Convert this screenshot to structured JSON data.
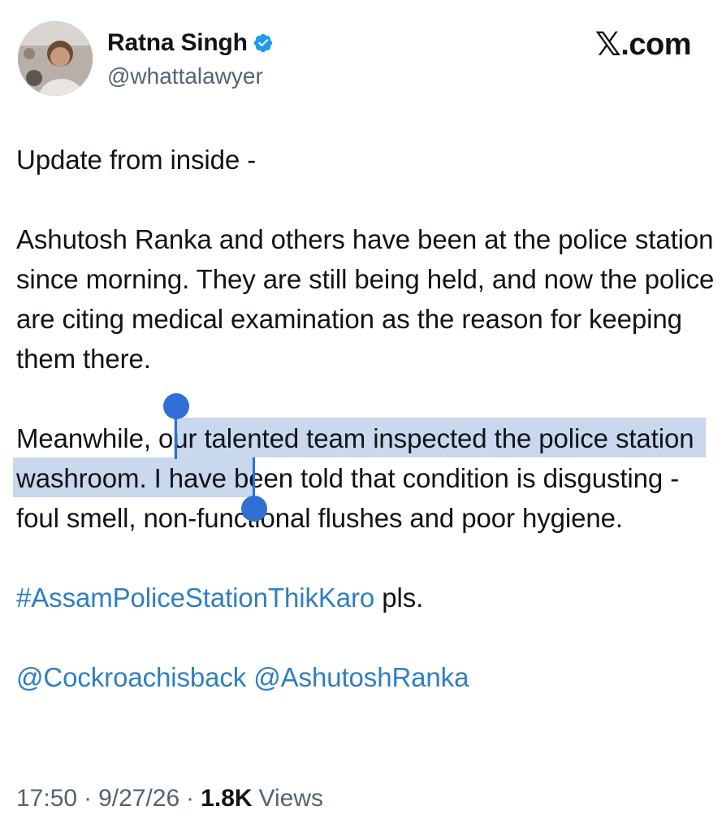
{
  "author": {
    "display_name": "Ratna Singh",
    "handle": "@whattalawyer",
    "verified": true,
    "avatar_icon": "profile-photo"
  },
  "brand": {
    "logo_glyph": "𝕏",
    "suffix": ".com"
  },
  "tweet": {
    "paragraph_1": "Update from inside -",
    "paragraph_2": "Ashutosh Ranka and others have been at the police station since morning. They are still being held, and now the police are citing medical examination as the reason for keeping them there.",
    "paragraph_3_before_selection": "Meanwhile, ",
    "paragraph_3_selected": "our talented team inspected the police station washroom",
    "paragraph_3_after_selection": ". I have been told that condition is disgusting - foul smell, non-functional flushes and poor hygiene.",
    "hashtag": "#AssamPoliceStationThikKaro",
    "hashtag_suffix": " pls.",
    "mention_1": "@Cockroachisback",
    "mention_2": "@AshutoshRanka"
  },
  "meta": {
    "time": "17:50",
    "separator": "·",
    "date": "9/27/26",
    "views_count": "1.8K",
    "views_label": "Views"
  },
  "colors": {
    "link": "#2f7fc1",
    "selection": "#c9d8ec",
    "selection_handle": "#2f6fd6",
    "verified_badge": "#1d9bf0",
    "secondary_text": "#536471"
  }
}
